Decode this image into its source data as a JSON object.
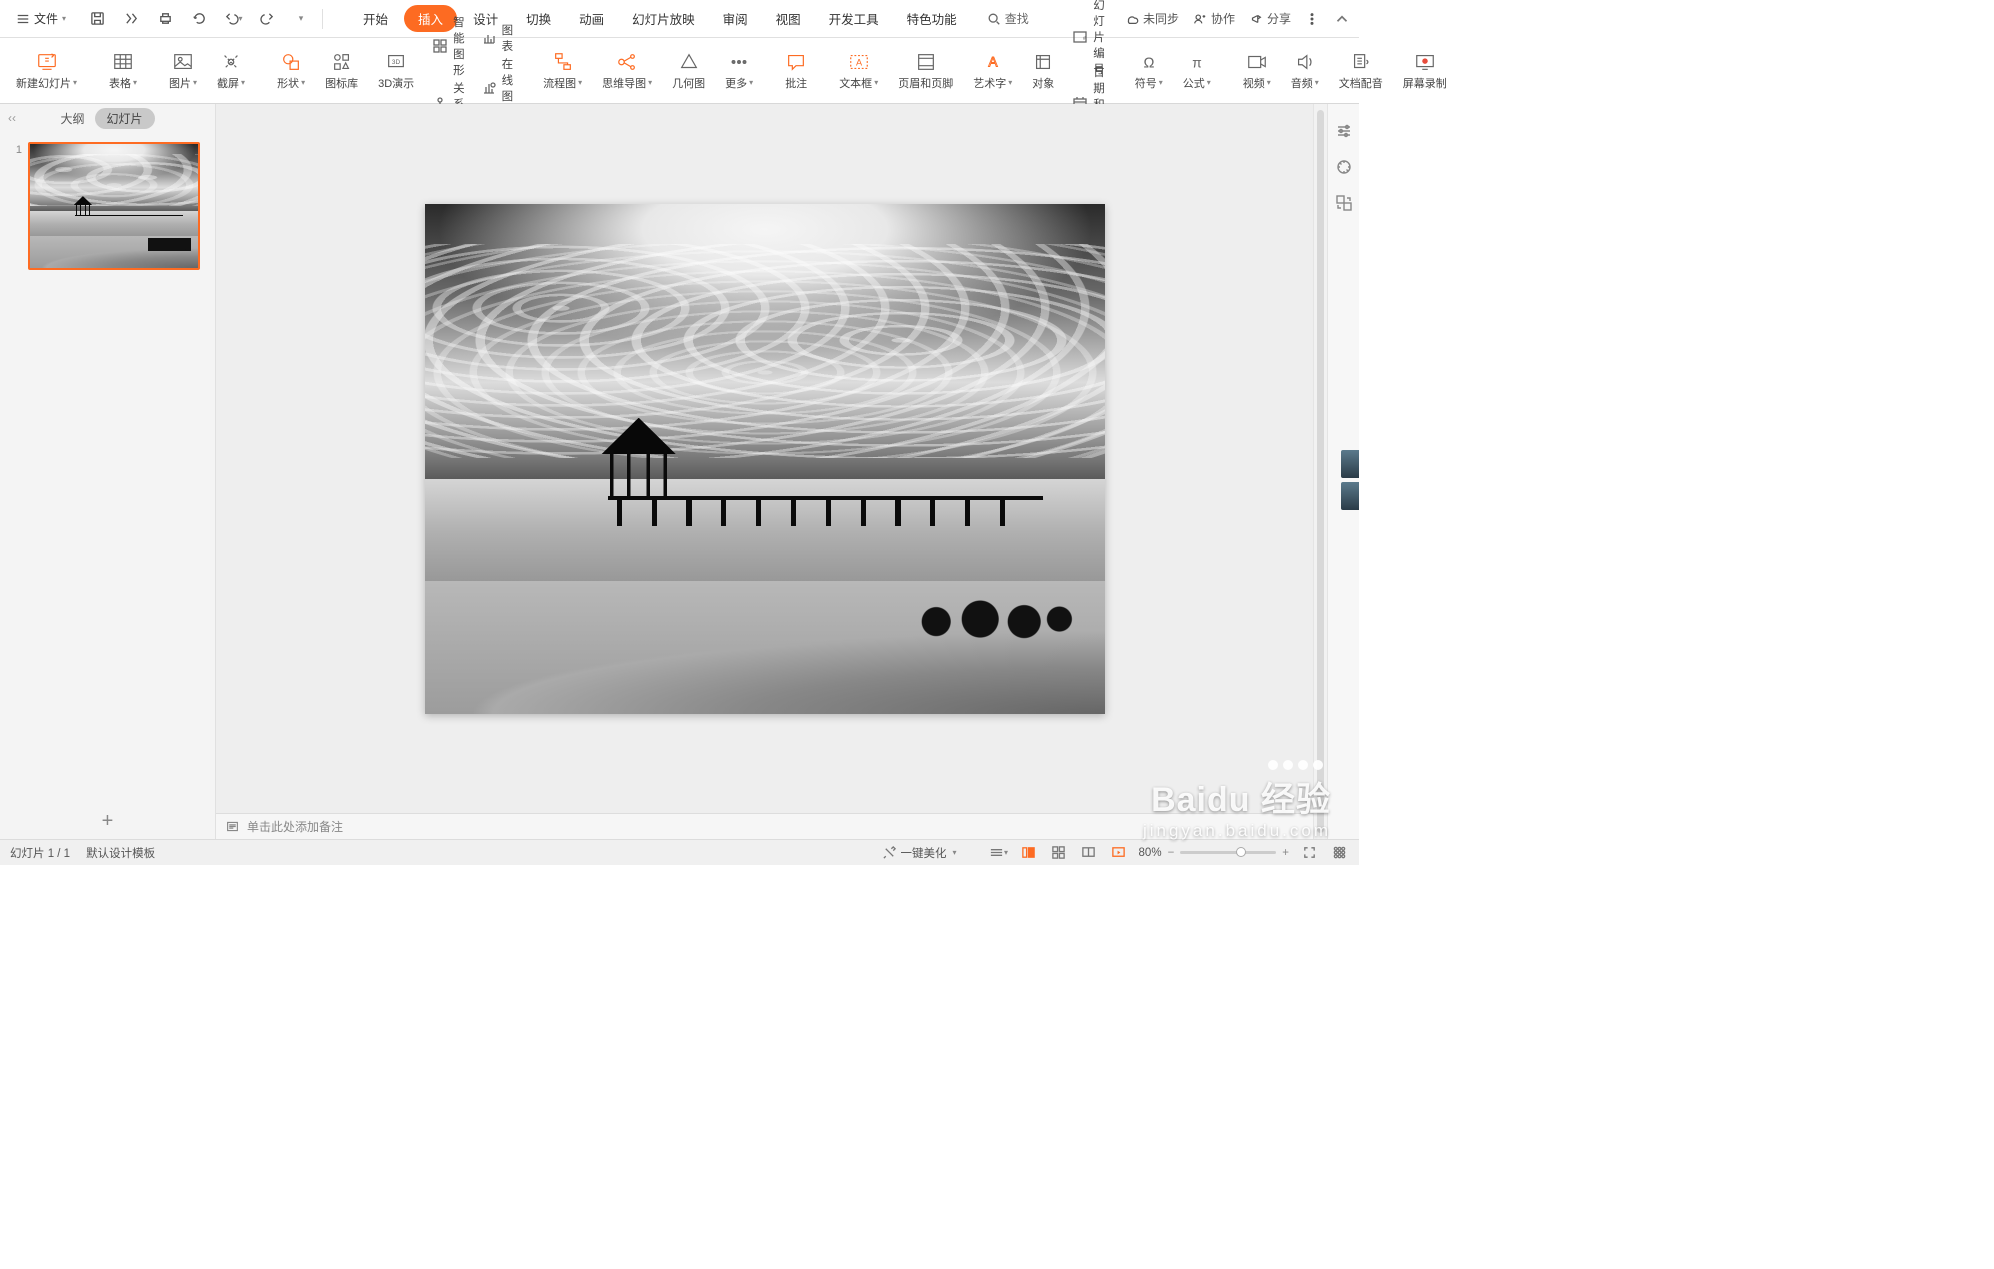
{
  "file_menu": "文件",
  "menu_tabs": [
    "开始",
    "插入",
    "设计",
    "切换",
    "动画",
    "幻灯片放映",
    "审阅",
    "视图",
    "开发工具",
    "特色功能"
  ],
  "active_tab_index": 1,
  "search_placeholder": "查找",
  "top_right": {
    "sync": "未同步",
    "collab": "协作",
    "share": "分享"
  },
  "ribbon": {
    "new_slide": "新建幻灯片",
    "table": "表格",
    "picture": "图片",
    "screenshot": "截屏",
    "shape": "形状",
    "icon_lib": "图标库",
    "presentation_3d": "3D演示",
    "smart_graphic": "智能图形",
    "chart": "图表",
    "relation": "关系图",
    "online_chart": "在线图表",
    "flowchart": "流程图",
    "mindmap": "思维导图",
    "geometry": "几何图",
    "more": "更多",
    "comment": "批注",
    "textbox": "文本框",
    "header_footer": "页眉和页脚",
    "wordart": "艺术字",
    "object": "对象",
    "slide_number": "幻灯片编号",
    "date_time": "日期和时间",
    "symbol": "符号",
    "equation": "公式",
    "video": "视频",
    "audio": "音频",
    "narration": "文档配音",
    "screen_rec": "屏幕录制"
  },
  "panel": {
    "outline": "大纲",
    "slides": "幻灯片",
    "thumb_number": "1"
  },
  "notes_placeholder": "单击此处添加备注",
  "status": {
    "slide_counter": "幻灯片 1 / 1",
    "template": "默认设计模板",
    "beautify": "一键美化",
    "zoom": "80%"
  },
  "watermark": {
    "brand": "Baidu 经验",
    "url": "jingyan.baidu.com"
  }
}
